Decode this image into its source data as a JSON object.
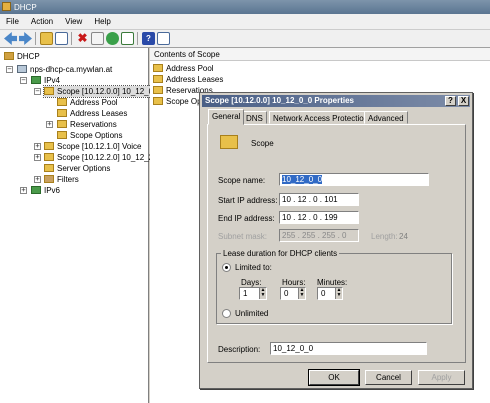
{
  "window": {
    "title": "DHCP"
  },
  "menu": [
    "File",
    "Action",
    "View",
    "Help"
  ],
  "toolbar_icons": [
    "back-icon",
    "forward-icon",
    "up-icon",
    "show-hide-tree-icon",
    "delete-icon",
    "properties-icon",
    "refresh-icon",
    "export-icon",
    "help-icon",
    "console-icon"
  ],
  "tree": {
    "root": "DHCP",
    "server": "nps-dhcp-ca.mywlan.at",
    "ipv4": "IPv4",
    "scope1": "Scope [10.12.0.0] 10_12_0",
    "scope1_children": [
      "Address Pool",
      "Address Leases",
      "Reservations",
      "Scope Options"
    ],
    "scope2": "Scope [10.12.1.0] Voice",
    "scope3": "Scope [10.12.2.0] 10_12_2",
    "server_options": "Server Options",
    "filters": "Filters",
    "ipv6": "IPv6"
  },
  "list": {
    "header": "Contents of Scope",
    "items": [
      "Address Pool",
      "Address Leases",
      "Reservations",
      "Scope Opti"
    ]
  },
  "dialog": {
    "title": "Scope [10.12.0.0] 10_12_0_0 Properties",
    "tabs": [
      "General",
      "DNS",
      "Network Access Protection",
      "Advanced"
    ],
    "heading": "Scope",
    "scope_name_label": "Scope name:",
    "scope_name": "10_12_0_0",
    "start_ip_label": "Start IP address:",
    "start_ip": "10 . 12 . 0 . 101",
    "end_ip_label": "End IP address:",
    "end_ip": "10 . 12 . 0 . 199",
    "subnet_label": "Subnet mask:",
    "subnet": "255 . 255 . 255 . 0",
    "length_label": "Length:",
    "length": "24",
    "lease_group": "Lease duration for DHCP clients",
    "limited_label": "Limited to:",
    "days_label": "Days:",
    "days": "1",
    "hours_label": "Hours:",
    "hours": "0",
    "minutes_label": "Minutes:",
    "minutes": "0",
    "unlimited_label": "Unlimited",
    "lease_mode": "limited",
    "description_label": "Description:",
    "description": "10_12_0_0",
    "ok": "OK",
    "cancel": "Cancel",
    "apply": "Apply",
    "help_btn": "?",
    "close_btn": "X"
  }
}
